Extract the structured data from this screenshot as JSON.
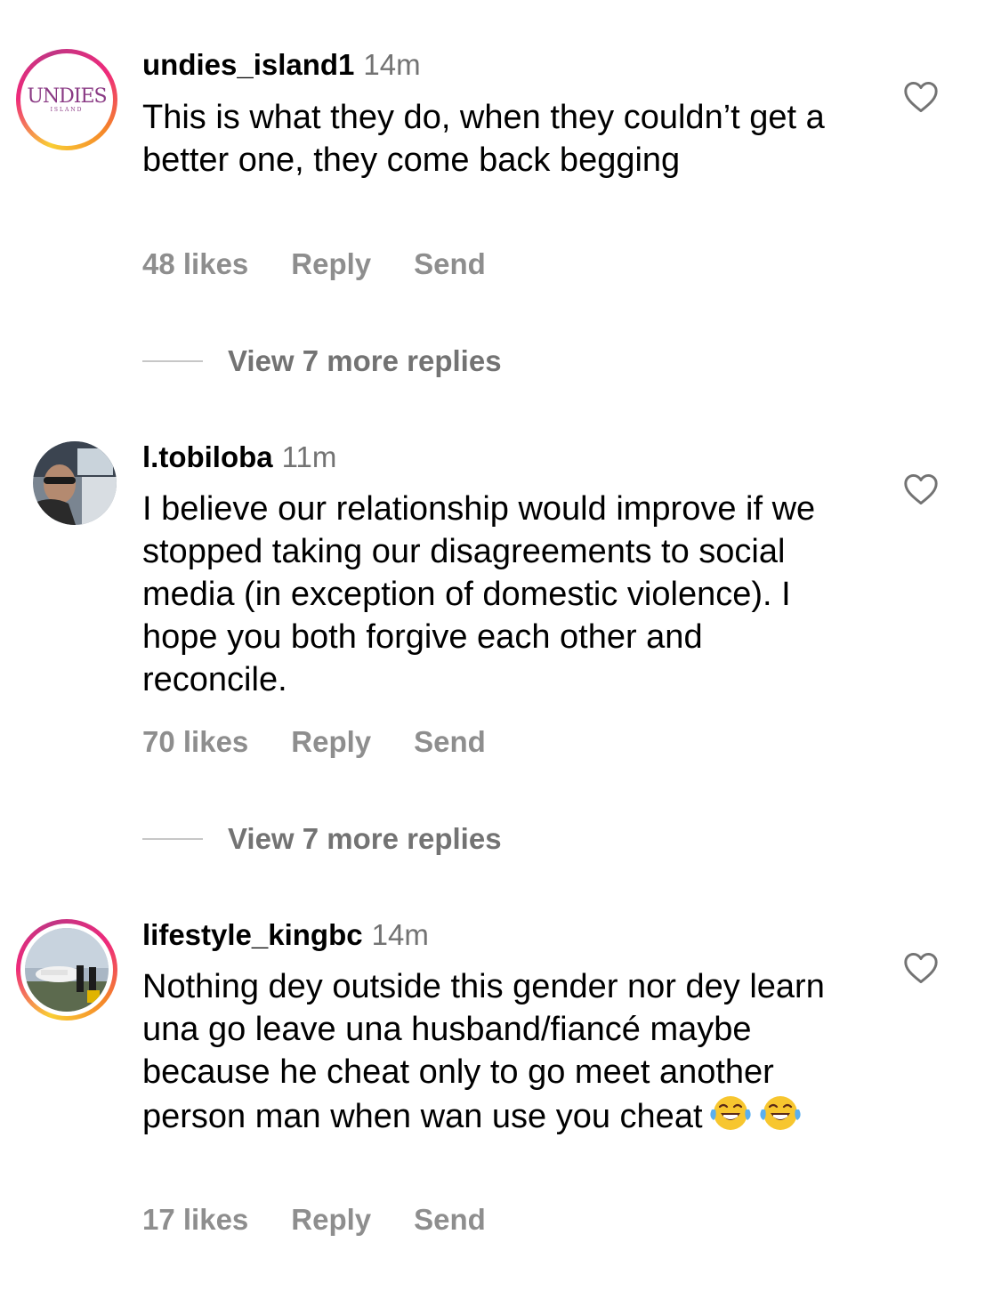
{
  "comments": [
    {
      "username": "undies_island1",
      "time": "14m",
      "text": "This is what they do, when they couldn’t get a better one, they come back begging",
      "likes": "48 likes",
      "reply_label": "Reply",
      "send_label": "Send",
      "avatar_logo": "UNDIES",
      "avatar_logo_sub": "ISLAND",
      "has_story_ring": true,
      "view_replies": "View 7 more replies"
    },
    {
      "username": "l.tobiloba",
      "time": "11m",
      "text": "I believe our relationship would improve if we stopped taking our disagreements to social media (in exception of domestic violence). I hope you both forgive each other and reconcile.",
      "likes": "70 likes",
      "reply_label": "Reply",
      "send_label": "Send",
      "has_story_ring": false,
      "view_replies": "View 7 more replies"
    },
    {
      "username": "lifestyle_kingbc",
      "time": "14m",
      "text": "Nothing dey outside this gender nor dey learn una go leave una husband/fiancé maybe because he cheat only to go meet another person man when wan use you cheat",
      "emoji": [
        "face-with-tears-of-joy",
        "face-with-tears-of-joy"
      ],
      "likes": "17 likes",
      "reply_label": "Reply",
      "send_label": "Send",
      "has_story_ring": true
    }
  ],
  "colors": {
    "secondary_text": "#737373",
    "action_text": "#8e8e8e",
    "divider": "#c7c7c7",
    "story_ring_start": "#f9ce34",
    "story_ring_mid": "#ee2a7b",
    "story_ring_end": "#c13584"
  },
  "icons": {
    "like": "heart-outline-icon"
  }
}
